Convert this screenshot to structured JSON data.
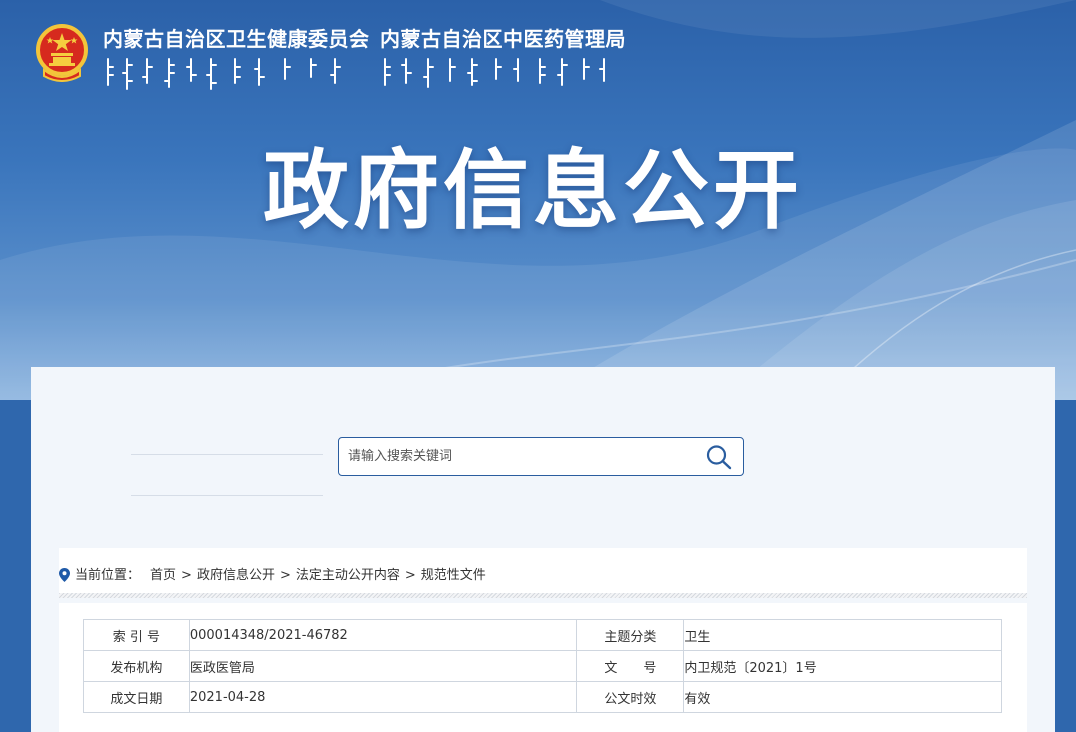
{
  "header": {
    "org_name_1": "内蒙古自治区卫生健康委员会",
    "org_name_2": "内蒙古自治区中医药管理局",
    "page_title": "政府信息公开"
  },
  "search": {
    "placeholder": "请输入搜索关键词",
    "icon": "search-icon"
  },
  "breadcrumb": {
    "prefix": "当前位置：",
    "items": [
      "首页",
      "政府信息公开",
      "法定主动公开内容",
      "规范性文件"
    ],
    "separator": ">"
  },
  "info_table": {
    "rows": [
      {
        "label_1": "索 引 号",
        "value_1": "000014348/2021-46782",
        "label_2": "主题分类",
        "value_2": "卫生"
      },
      {
        "label_1": "发布机构",
        "value_1": "医政医管局",
        "label_2": "文　　号",
        "value_2": "内卫规范〔2021〕1号"
      },
      {
        "label_1": "成文日期",
        "value_1": "2021-04-28",
        "label_2": "公文时效",
        "value_2": "有效"
      }
    ]
  },
  "colors": {
    "banner_top": "#2b61a9",
    "banner_bottom": "#8fb6e0",
    "accent": "#2a5d9f",
    "panel_bg": "#f2f6fb"
  }
}
